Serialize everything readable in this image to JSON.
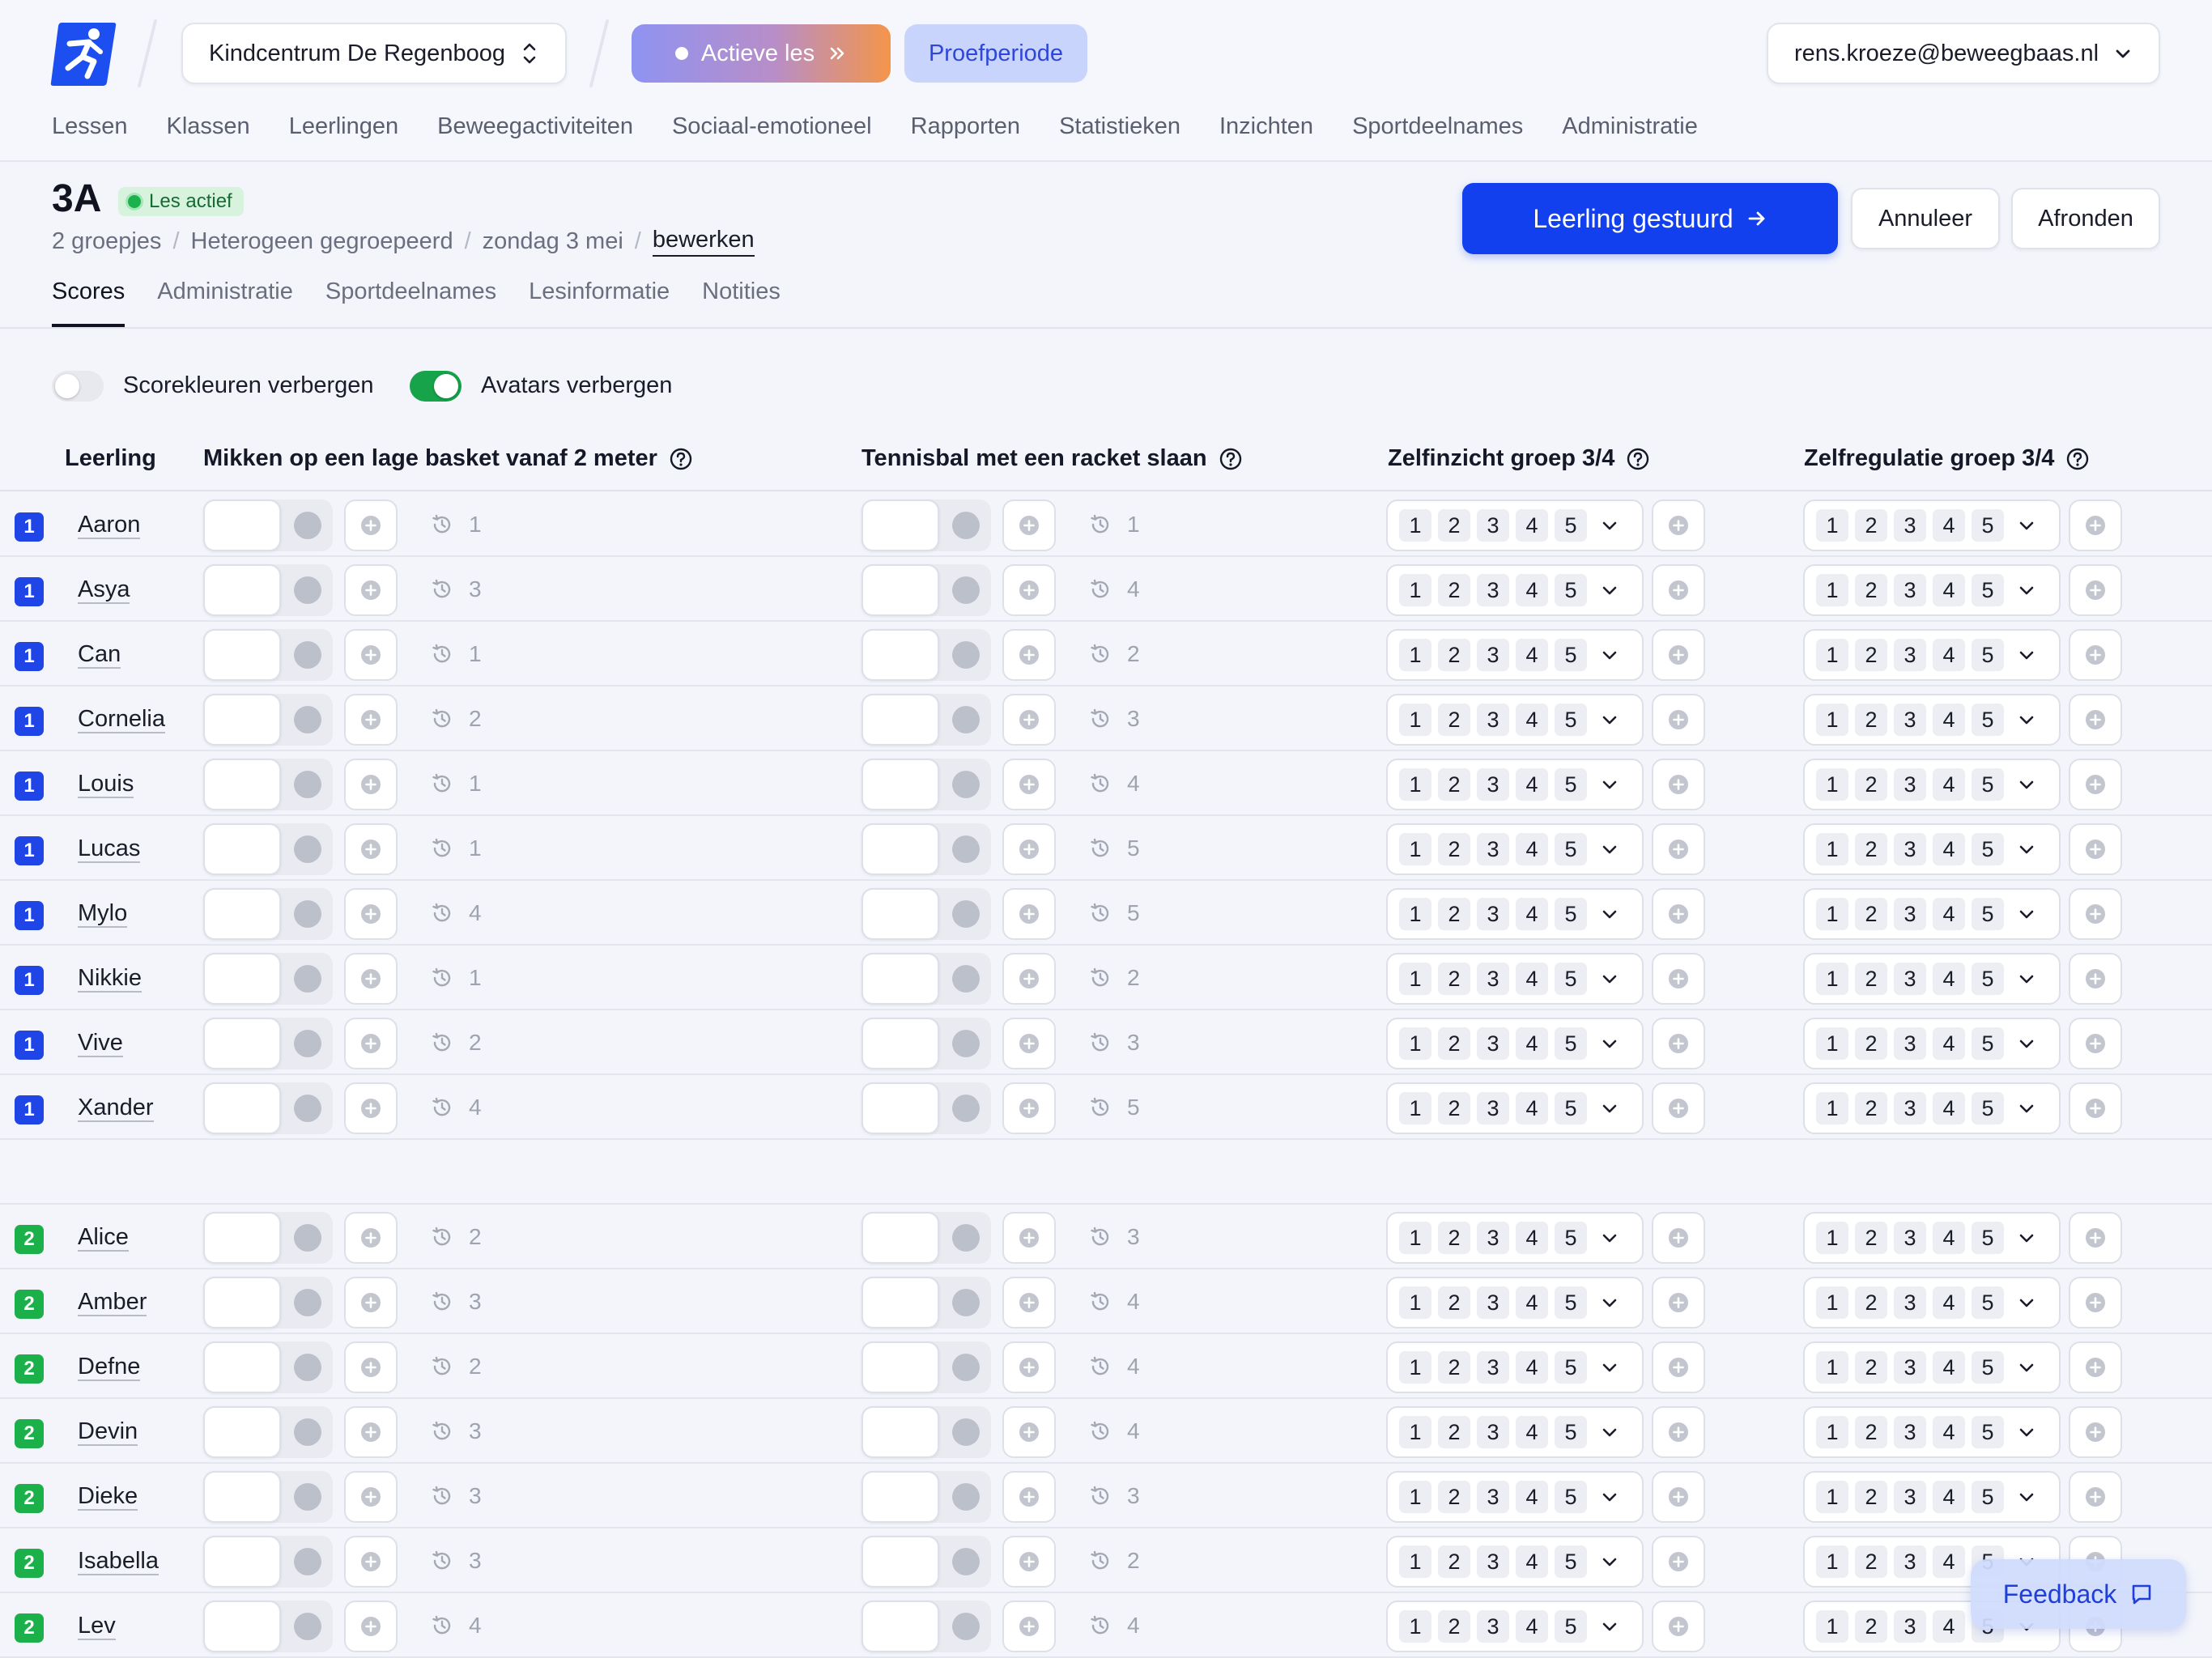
{
  "topbar": {
    "school": "Kindcentrum De Regenboog",
    "active_lesson": "Actieve les",
    "trial": "Proefperiode",
    "user": "rens.kroeze@beweegbaas.nl",
    "nav": [
      "Lessen",
      "Klassen",
      "Leerlingen",
      "Beweegactiviteiten",
      "Sociaal-emotioneel",
      "Rapporten",
      "Statistieken",
      "Inzichten",
      "Sportdeelnames",
      "Administratie"
    ]
  },
  "header": {
    "class_name": "3A",
    "status_badge": "Les actief",
    "breadcrumbs": [
      "2 groepjes",
      "Heterogeen gegroepeerd",
      "zondag 3 mei",
      "bewerken"
    ],
    "primary_button": "Leerling gestuurd",
    "cancel_button": "Annuleer",
    "finish_button": "Afronden",
    "tabs": [
      "Scores",
      "Administratie",
      "Sportdeelnames",
      "Lesinformatie",
      "Notities"
    ],
    "active_tab": "Scores"
  },
  "options": {
    "hide_score_colors": {
      "label": "Scorekleuren verbergen",
      "on": false
    },
    "hide_avatars": {
      "label": "Avatars verbergen",
      "on": true
    }
  },
  "table": {
    "columns": [
      "Leerling",
      "Mikken op een lage basket vanaf 2 meter",
      "Tennisbal met een racket slaan",
      "Zelfinzicht groep 3/4",
      "Zelfregulatie groep 3/4"
    ],
    "scale_options": [
      "1",
      "2",
      "3",
      "4",
      "5"
    ],
    "groups": [
      {
        "number": "1",
        "students": [
          {
            "name": "Aaron",
            "prev_a": "1",
            "prev_b": "1"
          },
          {
            "name": "Asya",
            "prev_a": "3",
            "prev_b": "4"
          },
          {
            "name": "Can",
            "prev_a": "1",
            "prev_b": "2"
          },
          {
            "name": "Cornelia",
            "prev_a": "2",
            "prev_b": "3"
          },
          {
            "name": "Louis",
            "prev_a": "1",
            "prev_b": "4"
          },
          {
            "name": "Lucas",
            "prev_a": "1",
            "prev_b": "5"
          },
          {
            "name": "Mylo",
            "prev_a": "4",
            "prev_b": "5"
          },
          {
            "name": "Nikkie",
            "prev_a": "1",
            "prev_b": "2"
          },
          {
            "name": "Vive",
            "prev_a": "2",
            "prev_b": "3"
          },
          {
            "name": "Xander",
            "prev_a": "4",
            "prev_b": "5"
          }
        ]
      },
      {
        "number": "2",
        "students": [
          {
            "name": "Alice",
            "prev_a": "2",
            "prev_b": "3"
          },
          {
            "name": "Amber",
            "prev_a": "3",
            "prev_b": "4"
          },
          {
            "name": "Defne",
            "prev_a": "2",
            "prev_b": "4"
          },
          {
            "name": "Devin",
            "prev_a": "3",
            "prev_b": "4"
          },
          {
            "name": "Dieke",
            "prev_a": "3",
            "prev_b": "3"
          },
          {
            "name": "Isabella",
            "prev_a": "3",
            "prev_b": "2"
          },
          {
            "name": "Lev",
            "prev_a": "4",
            "prev_b": "4"
          }
        ]
      }
    ]
  },
  "feedback": "Feedback",
  "colors": {
    "primary": "#1240EF",
    "group1": "#1F45E6",
    "group2": "#1CB04A",
    "active_green": "#16A34A"
  }
}
